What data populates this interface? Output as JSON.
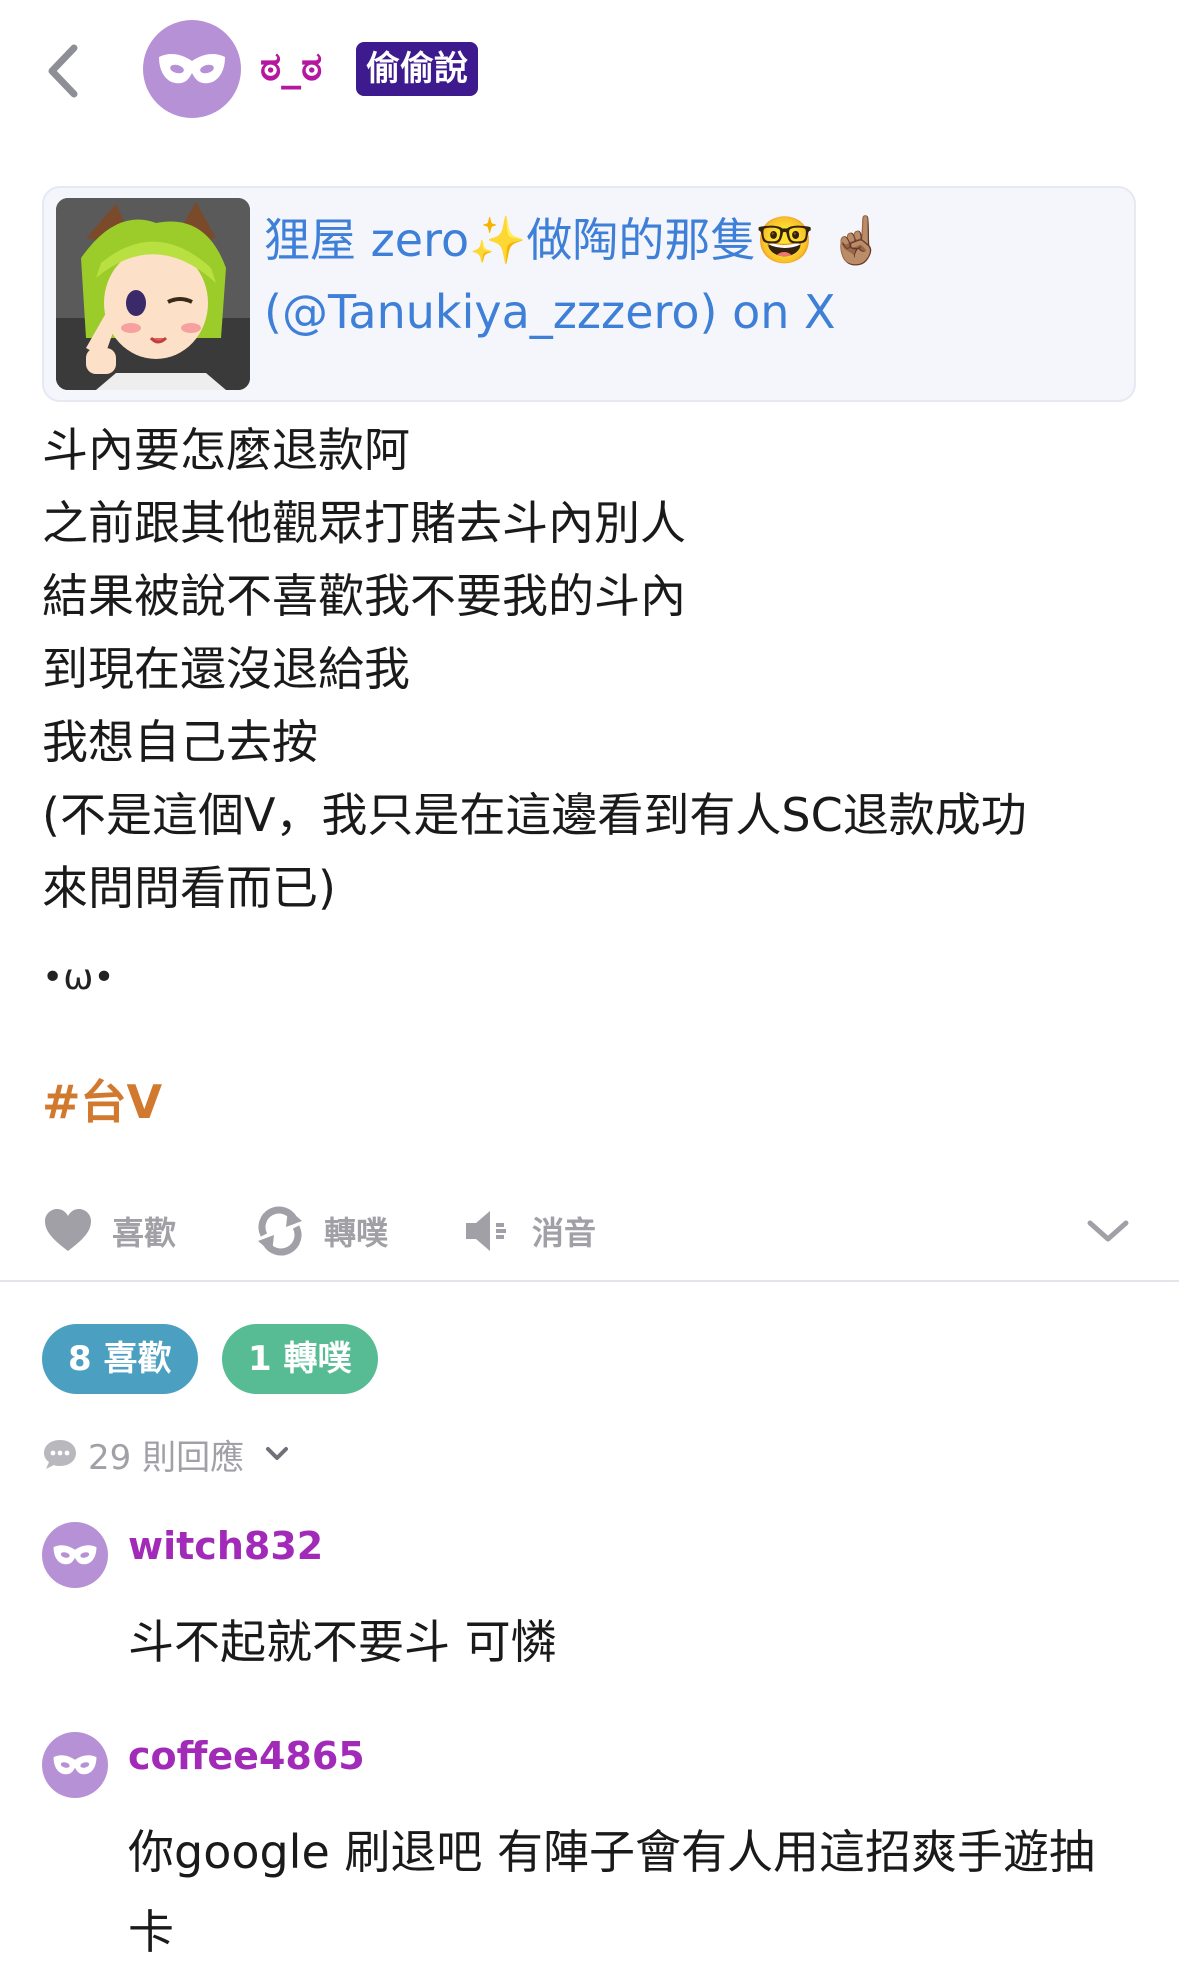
{
  "header": {
    "nick": "ಠ_ಠ",
    "badge": "偷偷說"
  },
  "link_card": {
    "title_line1": "狸屋 zero✨做陶的那隻🤓 ☝🏽",
    "title_line2": "(@Tanukiya_zzzero) on X"
  },
  "post": {
    "lines": [
      "斗內要怎麼退款阿",
      "之前跟其他觀眾打賭去斗內別人",
      "結果被說不喜歡我不要我的斗內",
      "到現在還沒退給我",
      "我想自己去按",
      "(不是這個V，我只是在這邊看到有人SC退款成功",
      "來問問看而已)"
    ],
    "kaomoji": "•ω•",
    "hashtag": "#台V"
  },
  "actions": {
    "like": "喜歡",
    "replurk": "轉噗",
    "mute": "消音"
  },
  "stats": {
    "likes": "8 喜歡",
    "replurks": "1 轉噗"
  },
  "responses": {
    "label": "29 則回應"
  },
  "comments": [
    {
      "user": "witch832",
      "text": "斗不起就不要斗 可憐"
    },
    {
      "user": "coffee4865",
      "text": "你google 刷退吧 有陣子會有人用這招爽手遊抽卡"
    }
  ],
  "colors": {
    "nick": "#b5179e",
    "badge_bg": "#3d1a8e",
    "link": "#3e7fd8",
    "hashtag": "#d17a2f",
    "likes_bg": "#4b9fc0",
    "replurks_bg": "#57bc93",
    "comment_user": "#a22ab8",
    "avatar": "#b691d6"
  }
}
